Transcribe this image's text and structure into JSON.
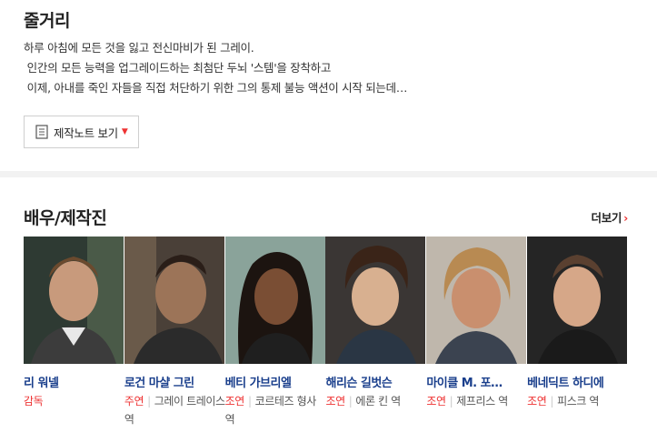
{
  "synopsis": {
    "title": "줄거리",
    "lines": [
      "하루 아침에 모든 것을 잃고 전신마비가 된 그레이.",
      " 인간의 모든 능력을 업그레이드하는 최첨단 두뇌 '스템'을 장착하고",
      " 이제, 아내를 죽인 자들을 직접 처단하기 위한 그의 통제 불능 액션이 시작 되는데…"
    ],
    "notes_button": "제작노트 보기"
  },
  "cast": {
    "title": "배우/제작진",
    "more_label": "더보기",
    "people": [
      {
        "name": "리 워넬",
        "role_type": "감독",
        "role": "",
        "photo_icon": "person-photo"
      },
      {
        "name": "로건 마샬 그린",
        "role_type": "주연",
        "role": "그레이 트레이스 역",
        "photo_icon": "person-photo"
      },
      {
        "name": "베티 가브리엘",
        "role_type": "조연",
        "role": "코르테즈 형사 역",
        "photo_icon": "person-photo"
      },
      {
        "name": "해리슨 길벗슨",
        "role_type": "조연",
        "role": "에론 킨 역",
        "photo_icon": "person-photo"
      },
      {
        "name": "마이클 M. 포…",
        "role_type": "조연",
        "role": "제프리스 역",
        "photo_icon": "person-photo"
      },
      {
        "name": "베네딕트 하디에",
        "role_type": "조연",
        "role": "피스크 역",
        "photo_icon": "person-photo"
      }
    ]
  },
  "colors": {
    "accent": "#e33333",
    "link": "#1a3f8c"
  }
}
